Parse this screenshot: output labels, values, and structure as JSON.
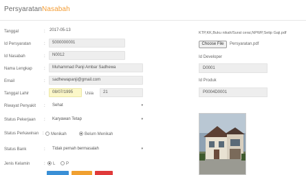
{
  "header": {
    "title_main": "Persyaratan",
    "title_accent": "Nasabah"
  },
  "form": {
    "tanggal": {
      "label": "Tanggal",
      "value": "2017-05-13"
    },
    "id_persyaratan": {
      "label": "Id Persyaratan",
      "value": "5000000001"
    },
    "id_nasabah": {
      "label": "Id Nasabah",
      "value": "N0012"
    },
    "nama_lengkap": {
      "label": "Nama Lengkap",
      "value": "Muhammad Panji Ambar Sadhewa"
    },
    "email": {
      "label": "Email",
      "value": "sadhewapanji@gmail.com"
    },
    "tanggal_lahir": {
      "label": "Tanggal Lahir",
      "value": "08/07/1995",
      "usia_label": "Usia",
      "usia_value": "21"
    },
    "riwayat_penyakit": {
      "label": "Riwayat Penyakit",
      "value": "Sehat"
    },
    "status_pekerjaan": {
      "label": "Status Pekerjaan",
      "value": "Karyawan Tetap"
    },
    "status_perkawinan": {
      "label": "Status Perkawinan",
      "option1": "Menikah",
      "option2": "Belum Menikah",
      "selected": "Belum Menikah"
    },
    "status_bank": {
      "label": "Status Bank",
      "value": "Tidak pernah bermasalah"
    },
    "jenis_kelamin": {
      "label": "Jenis Kelamin",
      "option1": "L",
      "option2": "P",
      "selected": "L"
    },
    "colon": ":"
  },
  "right": {
    "upload_label": "KTP,KK,Buku nikah/Surat cerai,NPWP,Setip Gaji.pdf",
    "file_button": "Choose File",
    "file_name": "Persyaratan.pdf",
    "id_developer": {
      "label": "Id Developer",
      "value": "D0001"
    },
    "id_produk": {
      "label": "Id Produk",
      "value": "P0004D0001"
    }
  },
  "colors": {
    "accent": "#f39c34",
    "button_blue": "#3a8fd6",
    "button_orange": "#f0a030",
    "button_red": "#e03a3a"
  }
}
